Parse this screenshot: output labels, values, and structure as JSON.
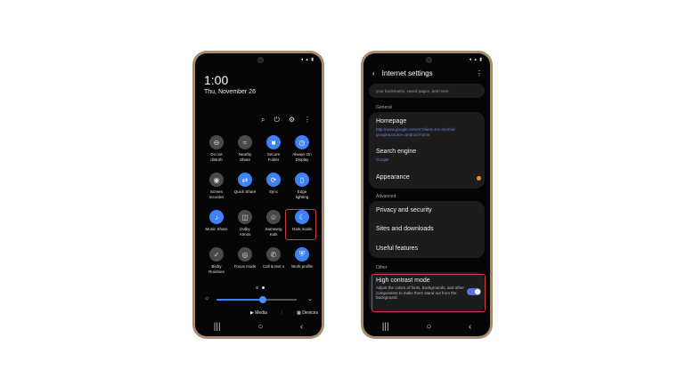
{
  "left_phone": {
    "time": "1:00",
    "date": "Thu, November 26",
    "tiles": [
      {
        "label": "Do not\ndisturb",
        "icon": "dnd-icon",
        "on": false
      },
      {
        "label": "Nearby\nShare",
        "icon": "nearby-share-icon",
        "on": false
      },
      {
        "label": "Secure\nFolder",
        "icon": "secure-folder-icon",
        "on": true
      },
      {
        "label": "Always On\nDisplay",
        "icon": "always-on-display-icon",
        "on": true
      },
      {
        "label": "Screen\nrecorder",
        "icon": "screen-recorder-icon",
        "on": false
      },
      {
        "label": "Quick Share",
        "icon": "quick-share-icon",
        "on": true
      },
      {
        "label": "Sync",
        "icon": "sync-icon",
        "on": true
      },
      {
        "label": "Edge\nlighting",
        "icon": "edge-lighting-icon",
        "on": true
      },
      {
        "label": "Music Share",
        "icon": "music-share-icon",
        "on": true
      },
      {
        "label": "Dolby\nAtmos",
        "icon": "dolby-icon",
        "on": false
      },
      {
        "label": "Samsung\nKids",
        "icon": "samsung-kids-icon",
        "on": false
      },
      {
        "label": "Dark mode",
        "icon": "dark-mode-icon",
        "on": true
      },
      {
        "label": "Bixby\nRoutines",
        "icon": "bixby-routines-icon",
        "on": false
      },
      {
        "label": "Focus mode",
        "icon": "focus-mode-icon",
        "on": false
      },
      {
        "label": "Call & text o",
        "icon": "call-text-icon",
        "on": false
      },
      {
        "label": "Work profile",
        "icon": "work-profile-icon",
        "on": true
      }
    ],
    "media_label": "Media",
    "devices_label": "Devices"
  },
  "right_phone": {
    "title": "Internet settings",
    "top_partial": "your bookmarks, saved pages, and more.",
    "section_general": "General",
    "homepage_label": "Homepage",
    "homepage_url": "http://www.google.com/m?client=ms-android-google&source=android-home",
    "search_engine_label": "Search engine",
    "search_engine_value": "Google",
    "appearance_label": "Appearance",
    "section_advanced": "Advanced",
    "privacy_label": "Privacy and security",
    "sites_label": "Sites and downloads",
    "useful_label": "Useful features",
    "section_other": "Other",
    "high_contrast_label": "High contrast mode",
    "high_contrast_desc": "Adjust the colors of fonts, backgrounds, and other components to make them stand out from the background.",
    "high_contrast_on": true
  },
  "colors": {
    "accent": "#3e82f7",
    "highlight": "#d23a45",
    "phone_frame": "#a88a6c",
    "toggle": "#5b6ed9",
    "notification_dot": "#f08a2c"
  }
}
